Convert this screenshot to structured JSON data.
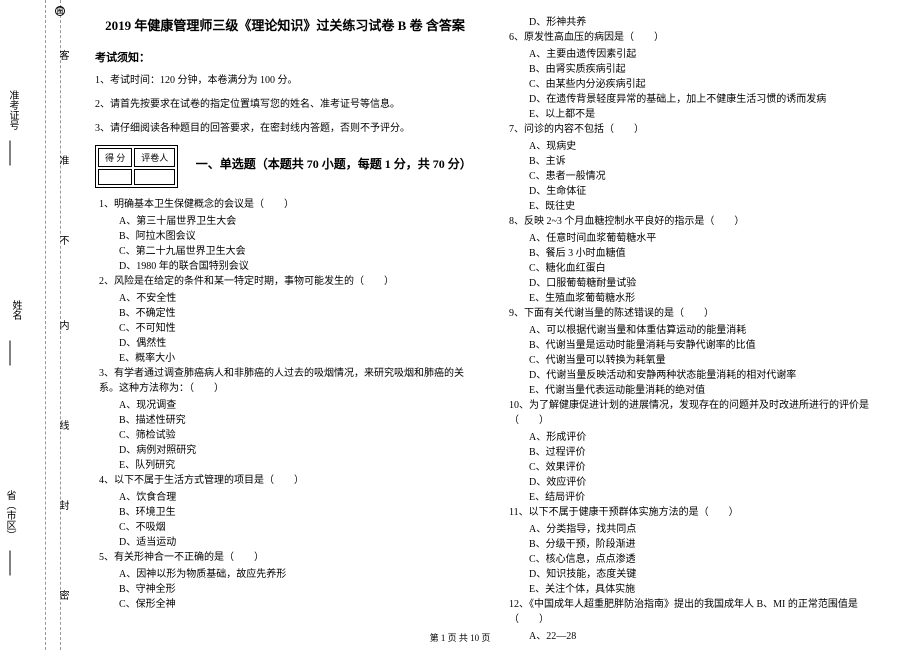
{
  "sidebar": {
    "exam_label": "准考证号",
    "name_label": "姓名",
    "province_label": "省（市区）",
    "line_labels": [
      "客",
      "准",
      "不",
      "内",
      "线",
      "封",
      "密"
    ],
    "top_circle": "圈"
  },
  "header": {
    "title": "2019 年健康管理师三级《理论知识》过关练习试卷 B 卷  含答案"
  },
  "instructions": {
    "heading": "考试须知：",
    "items": [
      "1、考试时间：120 分钟，本卷满分为 100 分。",
      "2、请首先按要求在试卷的指定位置填写您的姓名、准考证号等信息。",
      "3、请仔细阅读各种题目的回答要求，在密封线内答题，否则不予评分。"
    ]
  },
  "scorebox": {
    "left": "得 分",
    "right": "评卷人"
  },
  "part1_title": "一、单选题（本题共 70 小题，每题 1 分，共 70 分）",
  "questions_left": [
    {
      "stem": "1、明确基本卫生保健概念的会议是（　　）",
      "opts": [
        "A、第三十届世界卫生大会",
        "B、阿拉木图会议",
        "C、第二十九届世界卫生大会",
        "D、1980 年的联合国特别会议"
      ]
    },
    {
      "stem": "2、风险是在给定的条件和某一特定时期，事物可能发生的（　　）",
      "opts": [
        "A、不安全性",
        "B、不确定性",
        "C、不可知性",
        "D、偶然性",
        "E、概率大小"
      ]
    },
    {
      "stem": "3、有学者通过调查肺癌病人和非肺癌的人过去的吸烟情况，来研究吸烟和肺癌的关系。这种方法称为：（　　）",
      "opts": [
        "A、现况调查",
        "B、描述性研究",
        "C、筛检试验",
        "D、病例对照研究",
        "E、队列研究"
      ]
    },
    {
      "stem": "4、以下不属于生活方式管理的项目是（　　）",
      "opts": [
        "A、饮食合理",
        "B、环境卫生",
        "C、不吸烟",
        "D、适当运动"
      ]
    },
    {
      "stem": "5、有关形神合一不正确的是（　　）",
      "opts": [
        "A、因神以形为物质基础，故应先养形",
        "B、守神全形",
        "C、保形全神"
      ]
    }
  ],
  "questions_right_prefix": {
    "opt": "D、形神共养"
  },
  "questions_right": [
    {
      "stem": "6、原发性高血压的病因是（　　）",
      "opts": [
        "A、主要由遗传因素引起",
        "B、由肾实质疾病引起",
        "C、由某些内分泌疾病引起",
        "D、在遗传背景轻度异常的基础上，加上不健康生活习惯的诱而发病",
        "E、以上都不是"
      ]
    },
    {
      "stem": "7、问诊的内容不包括（　　）",
      "opts": [
        "A、现病史",
        "B、主诉",
        "C、患者一般情况",
        "D、生命体征",
        "E、既往史"
      ]
    },
    {
      "stem": "8、反映 2~3 个月血糖控制水平良好的指示是（　　）",
      "opts": [
        "A、任意时间血浆葡萄糖水平",
        "B、餐后 3 小时血糖值",
        "C、糖化血红蛋白",
        "D、口服葡萄糖耐量试验",
        "E、生殖血浆葡萄糖水形"
      ]
    },
    {
      "stem": "9、下面有关代谢当量的陈述错误的是（　　）",
      "opts": [
        "A、可以根据代谢当量和体重估算运动的能量消耗",
        "B、代谢当量是运动时能量消耗与安静代谢率的比值",
        "C、代谢当量可以转换为耗氧量",
        "D、代谢当量反映活动和安静两种状态能量消耗的相对代谢率",
        "E、代谢当量代表运动能量消耗的绝对值"
      ]
    },
    {
      "stem": "10、为了解健康促进计划的进展情况，发现存在的问题并及时改进所进行的评价是（　　）",
      "opts": [
        "A、形成评价",
        "B、过程评价",
        "C、效果评价",
        "D、效应评价",
        "E、结局评价"
      ]
    },
    {
      "stem": "11、以下不属于健康干预群体实施方法的是（　　）",
      "opts": [
        "A、分类指导，找共同点",
        "B、分级干预，阶段渐进",
        "C、核心信息，点点渗透",
        "D、知识技能，态度关键",
        "E、关注个体，具体实施"
      ]
    },
    {
      "stem": "12、《中国成年人超重肥胖防治指南》提出的我国成年人 B、MI 的正常范围值是（　　）",
      "opts": [
        "A、22—28"
      ]
    }
  ],
  "footer": "第 1 页 共 10 页"
}
